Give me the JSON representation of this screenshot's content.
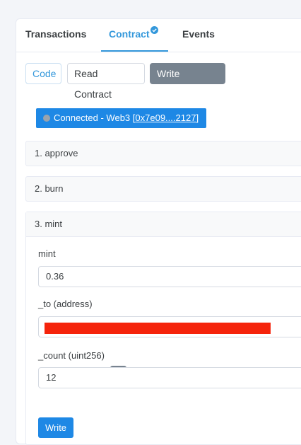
{
  "tabs": {
    "transactions": "Transactions",
    "contract": "Contract",
    "events": "Events"
  },
  "subnav": {
    "code": "Code",
    "read": "Read Contract",
    "write": "Write Contract"
  },
  "connection": {
    "status_text": "Connected - Web3 ",
    "address_open": "[",
    "address": "0x7e09....2127",
    "address_close": "]"
  },
  "functions": {
    "approve": "1. approve",
    "burn": "2. burn",
    "mint": "3. mint"
  },
  "mint_form": {
    "payable_label": "mint",
    "payable_value": "0.36",
    "to_label": "_to (address)",
    "count_label": "_count (uint256)",
    "count_value": "12",
    "plus_label": "+",
    "write_label": "Write"
  },
  "colors": {
    "accent": "#3498db",
    "button_blue": "#1e88e5",
    "secondary": "#77838f",
    "redaction": "#f5240c"
  },
  "icons": {
    "verified": "check-circle-icon",
    "status": "status-dot-icon"
  }
}
